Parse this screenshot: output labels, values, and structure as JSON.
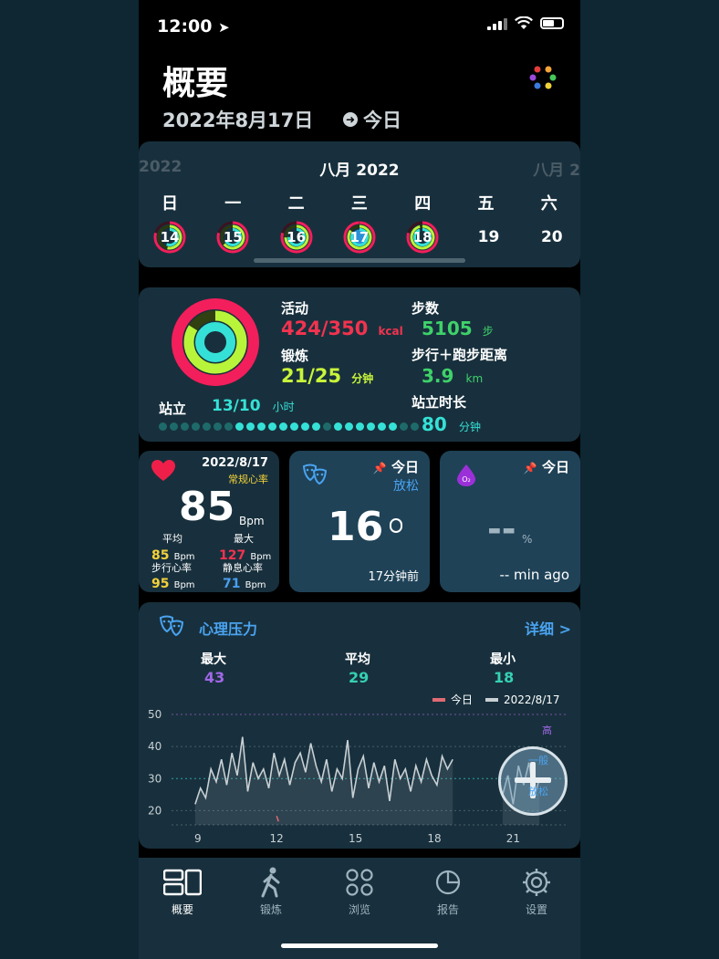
{
  "status_bar": {
    "time": "12:00"
  },
  "header": {
    "title": "概要",
    "date": "2022年8月17日",
    "today_label": "今日"
  },
  "calendar": {
    "prev_label": "2022",
    "month_label": "八月 2022",
    "next_label": "八月 2",
    "weekdays": [
      "日",
      "一",
      "二",
      "三",
      "四",
      "五",
      "六"
    ],
    "days": [
      "14",
      "15",
      "16",
      "17",
      "18",
      "19",
      "20"
    ]
  },
  "activity": {
    "move_label": "活动",
    "move_value": "424/350",
    "move_unit": "kcal",
    "exercise_label": "锻炼",
    "exercise_value": "21/25",
    "exercise_unit": "分钟",
    "stand_label": "站立",
    "stand_value": "13/10",
    "stand_unit": "小时",
    "steps_label": "步数",
    "steps_value": "5105",
    "steps_unit": "步",
    "distance_label": "步行＋跑步距离",
    "distance_value": "3.9",
    "distance_unit": "km",
    "stand_time_label": "站立时长",
    "stand_time_value": "80",
    "stand_time_unit": "分钟"
  },
  "heart": {
    "date": "2022/8/17",
    "subtitle": "常规心率",
    "value": "85",
    "unit": "Bpm",
    "avg_label": "平均",
    "avg_value": "85",
    "max_label": "最大",
    "max_value": "127",
    "walk_label": "步行心率",
    "walk_value": "95",
    "rest_label": "静息心率",
    "rest_value": "71",
    "small_unit": "Bpm"
  },
  "stress_card": {
    "pin_label": "今日",
    "state": "放松",
    "value": "16",
    "ago": "17分钟前"
  },
  "oxygen_card": {
    "pin_label": "今日",
    "value": "--",
    "unit": "%",
    "ago": "-- min ago"
  },
  "stress_section": {
    "title": "心理压力",
    "detail": "详细 >",
    "max_label": "最大",
    "max_value": "43",
    "avg_label": "平均",
    "avg_value": "29",
    "min_label": "最小",
    "min_value": "18",
    "legend_today": "今日",
    "legend_date": "2022/8/17",
    "level_high": "高",
    "level_normal": "一般",
    "level_relax": "放松"
  },
  "chart_data": {
    "type": "line",
    "title": "",
    "ylim": [
      15,
      52
    ],
    "xlim": [
      8,
      23
    ],
    "yticks": [
      20,
      30,
      40,
      50
    ],
    "xticks": [
      9,
      12,
      15,
      18,
      21
    ],
    "grid": true,
    "legend_placement": "top-right",
    "colors": {
      "today": "#e06a73",
      "date": "#c8d0d4"
    },
    "series": [
      {
        "name": "2022/8/17",
        "x": [
          8.9,
          9.1,
          9.3,
          9.5,
          9.7,
          9.9,
          10.1,
          10.3,
          10.5,
          10.7,
          10.9,
          11.1,
          11.3,
          11.5,
          11.7,
          11.9,
          12.1,
          12.3,
          12.5,
          12.7,
          12.9,
          13.1,
          13.3,
          13.5,
          13.7,
          13.9,
          14.1,
          14.3,
          14.5,
          14.7,
          14.9,
          15.1,
          15.3,
          15.5,
          15.7,
          15.9,
          16.1,
          16.3,
          16.5,
          16.7,
          16.9,
          17.1,
          17.3,
          17.5,
          17.7,
          17.9,
          18.1,
          18.3,
          18.5,
          18.7,
          20.6,
          20.8,
          21.0,
          21.2,
          21.4,
          21.6,
          21.8,
          22.0
        ],
        "y": [
          22,
          27,
          24,
          33,
          29,
          36,
          28,
          38,
          31,
          43,
          26,
          35,
          30,
          33,
          27,
          38,
          31,
          36,
          28,
          35,
          38,
          32,
          41,
          34,
          29,
          36,
          26,
          33,
          30,
          42,
          24,
          33,
          37,
          27,
          35,
          29,
          34,
          23,
          36,
          30,
          33,
          26,
          34,
          29,
          36,
          31,
          28,
          37,
          33,
          36,
          25,
          31,
          22,
          34,
          28,
          35,
          24,
          30
        ]
      },
      {
        "name": "今日",
        "x": [
          12.0
        ],
        "y": [
          17.5
        ]
      }
    ]
  },
  "tabs": [
    {
      "label": "概要",
      "icon": "overview-icon"
    },
    {
      "label": "锻炼",
      "icon": "walker-icon"
    },
    {
      "label": "浏览",
      "icon": "grid-icon"
    },
    {
      "label": "报告",
      "icon": "pie-icon"
    },
    {
      "label": "设置",
      "icon": "gear-icon"
    }
  ]
}
